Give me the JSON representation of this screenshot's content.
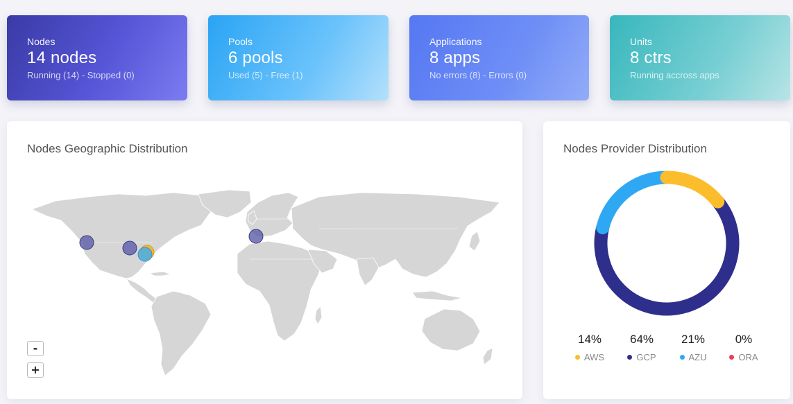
{
  "cards": [
    {
      "key": "Nodes",
      "value": "14 nodes",
      "sub": "Running (14) - Stopped (0)"
    },
    {
      "key": "Pools",
      "value": "6 pools",
      "sub": "Used (5) - Free (1)"
    },
    {
      "key": "Applications",
      "value": "8 apps",
      "sub": "No errors (8) - Errors (0)"
    },
    {
      "key": "Units",
      "value": "8 ctrs",
      "sub": "Running accross apps"
    }
  ],
  "geo": {
    "title": "Nodes Geographic Distribution",
    "zoom_out_label": "-",
    "zoom_in_label": "+",
    "markers": [
      {
        "place": "US West Coast",
        "color": "#5c5cab"
      },
      {
        "place": "US Central",
        "color": "#5c5cab"
      },
      {
        "place": "US East (AWS)",
        "color": "#f9b52a"
      },
      {
        "place": "US East (Azure)",
        "color": "#45aee8"
      },
      {
        "place": "Western Europe",
        "color": "#5c5cab"
      }
    ]
  },
  "provider": {
    "title": "Nodes Provider Distribution",
    "legend": [
      {
        "pct": "14%",
        "label": "AWS",
        "color": "#fbbd2c",
        "share": 14
      },
      {
        "pct": "64%",
        "label": "GCP",
        "color": "#2e2f8c",
        "share": 64
      },
      {
        "pct": "21%",
        "label": "AZU",
        "color": "#2ea8f3",
        "share": 21
      },
      {
        "pct": "0%",
        "label": "ORA",
        "color": "#f03a55",
        "share": 0
      }
    ]
  }
}
